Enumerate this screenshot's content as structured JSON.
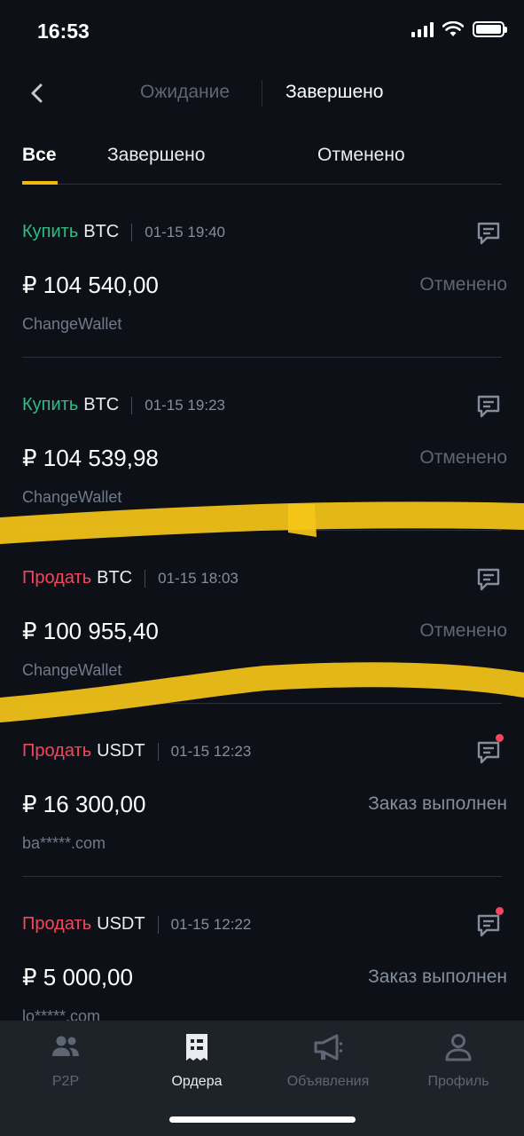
{
  "status_bar": {
    "time": "16:53"
  },
  "header": {
    "tabs": [
      {
        "label": "Ожидание",
        "active": false
      },
      {
        "label": "Завершено",
        "active": true
      }
    ]
  },
  "filter_tabs": [
    {
      "label": "Все",
      "active": true
    },
    {
      "label": "Завершено",
      "active": false
    },
    {
      "label": "Отменено",
      "active": false
    }
  ],
  "orders": [
    {
      "side": "Купить",
      "side_type": "buy",
      "asset": "BTC",
      "time": "01-15 19:40",
      "amount": "₽ 104 540,00",
      "status": "Отменено",
      "counterparty": "ChangeWallet",
      "unread": false
    },
    {
      "side": "Купить",
      "side_type": "buy",
      "asset": "BTC",
      "time": "01-15 19:23",
      "amount": "₽ 104 539,98",
      "status": "Отменено",
      "counterparty": "ChangeWallet",
      "unread": false
    },
    {
      "side": "Продать",
      "side_type": "sell",
      "asset": "BTC",
      "time": "01-15 18:03",
      "amount": "₽ 100 955,40",
      "status": "Отменено",
      "counterparty": "ChangeWallet",
      "unread": false
    },
    {
      "side": "Продать",
      "side_type": "sell",
      "asset": "USDT",
      "time": "01-15 12:23",
      "amount": "₽ 16 300,00",
      "status": "Заказ выполнен",
      "counterparty": "ba*****.com",
      "unread": true
    },
    {
      "side": "Продать",
      "side_type": "sell",
      "asset": "USDT",
      "time": "01-15 12:22",
      "amount": "₽ 5 000,00",
      "status": "Заказ выполнен",
      "counterparty": "lo*****.com",
      "unread": true
    }
  ],
  "bottom_nav": [
    {
      "label": "P2P",
      "icon": "users-icon",
      "active": false
    },
    {
      "label": "Ордера",
      "icon": "receipt-icon",
      "active": true
    },
    {
      "label": "Объявления",
      "icon": "megaphone-icon",
      "active": false
    },
    {
      "label": "Профиль",
      "icon": "profile-icon",
      "active": false
    }
  ],
  "colors": {
    "background": "#0d1017",
    "accent": "#f0b90b",
    "buy": "#2ebd85",
    "sell": "#f6465d",
    "highlight": "#f5c518"
  }
}
